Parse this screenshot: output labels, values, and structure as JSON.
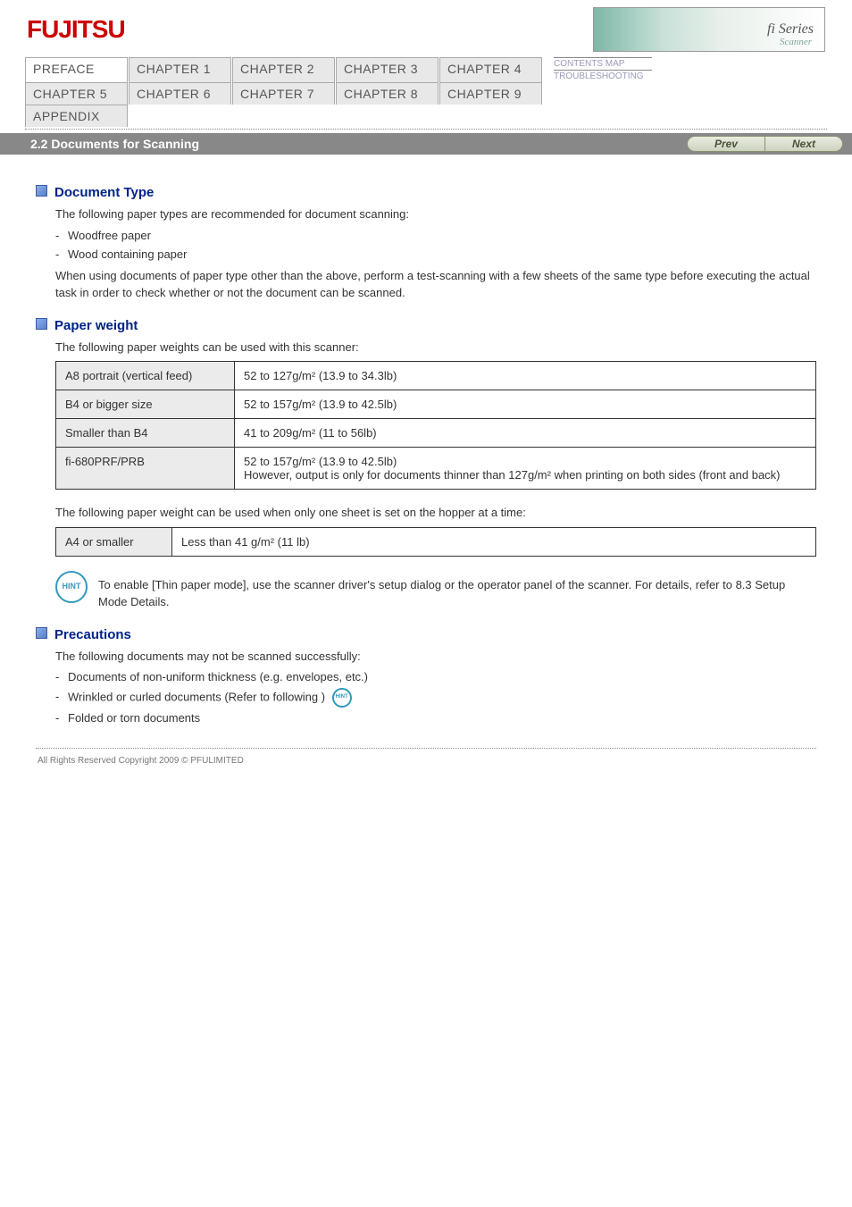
{
  "header": {
    "logo_text": "FUJITSU",
    "series_label": "fi Series",
    "series_sub": "Scanner"
  },
  "nav": {
    "rows": [
      [
        "PREFACE",
        "CHAPTER 1",
        "CHAPTER 2",
        "CHAPTER 3",
        "CHAPTER 4"
      ],
      [
        "CHAPTER 5",
        "CHAPTER 6",
        "CHAPTER 7",
        "CHAPTER 8",
        "CHAPTER 9"
      ],
      [
        "APPENDIX"
      ]
    ],
    "side_links": [
      "CONTENTS MAP",
      "TROUBLESHOOTING"
    ]
  },
  "titlebar": {
    "title": "2.2 Documents for Scanning",
    "prev": "Prev",
    "next": "Next"
  },
  "section_type": {
    "heading": "Document Type",
    "intro": "The following paper types are recommended for document scanning:",
    "items": [
      "Woodfree paper",
      "Wood containing paper"
    ],
    "note": "When using documents of paper type other than the above, perform a test-scanning with a few sheets of the same type before executing the actual task in order to check whether or not the document can be scanned."
  },
  "section_weight": {
    "heading": "Paper weight",
    "intro": "The following paper weights can be used with this scanner:",
    "table": [
      {
        "h": "A8 portrait (vertical feed)",
        "d": "52 to 127g/m² (13.9 to 34.3lb)"
      },
      {
        "h": "B4 or bigger size",
        "d": "52 to 157g/m² (13.9 to 42.5lb)"
      },
      {
        "h": "Smaller than B4",
        "d": "41 to 209g/m² (11 to 56lb)"
      },
      {
        "h": "fi-680PRF/PRB",
        "d": "52 to 157g/m² (13.9 to 42.5lb)\nHowever, output is only for documents thinner than 127g/m² when printing on both sides (front and back)"
      }
    ],
    "single_intro": "The following paper weight can be used when only one sheet is set on the hopper at a time:",
    "single_table": [
      {
        "h": "A4 or smaller",
        "d": "Less than 41 g/m² (11 lb)"
      }
    ],
    "hint": "To enable [Thin paper mode], use the scanner driver's setup dialog or the operator panel of the scanner. For details, refer to 8.3 Setup Mode Details."
  },
  "section_precautions": {
    "heading": "Precautions",
    "intro": "The following documents may not be scanned successfully:",
    "items": [
      "Documents of non-uniform thickness (e.g. envelopes, etc.)",
      "Wrinkled or curled documents (Refer to following )",
      "Folded or torn documents"
    ],
    "hint_icon_label": "HINT"
  },
  "footer": {
    "copyright": "All Rights Reserved Copyright 2009 © PFULIMITED"
  }
}
